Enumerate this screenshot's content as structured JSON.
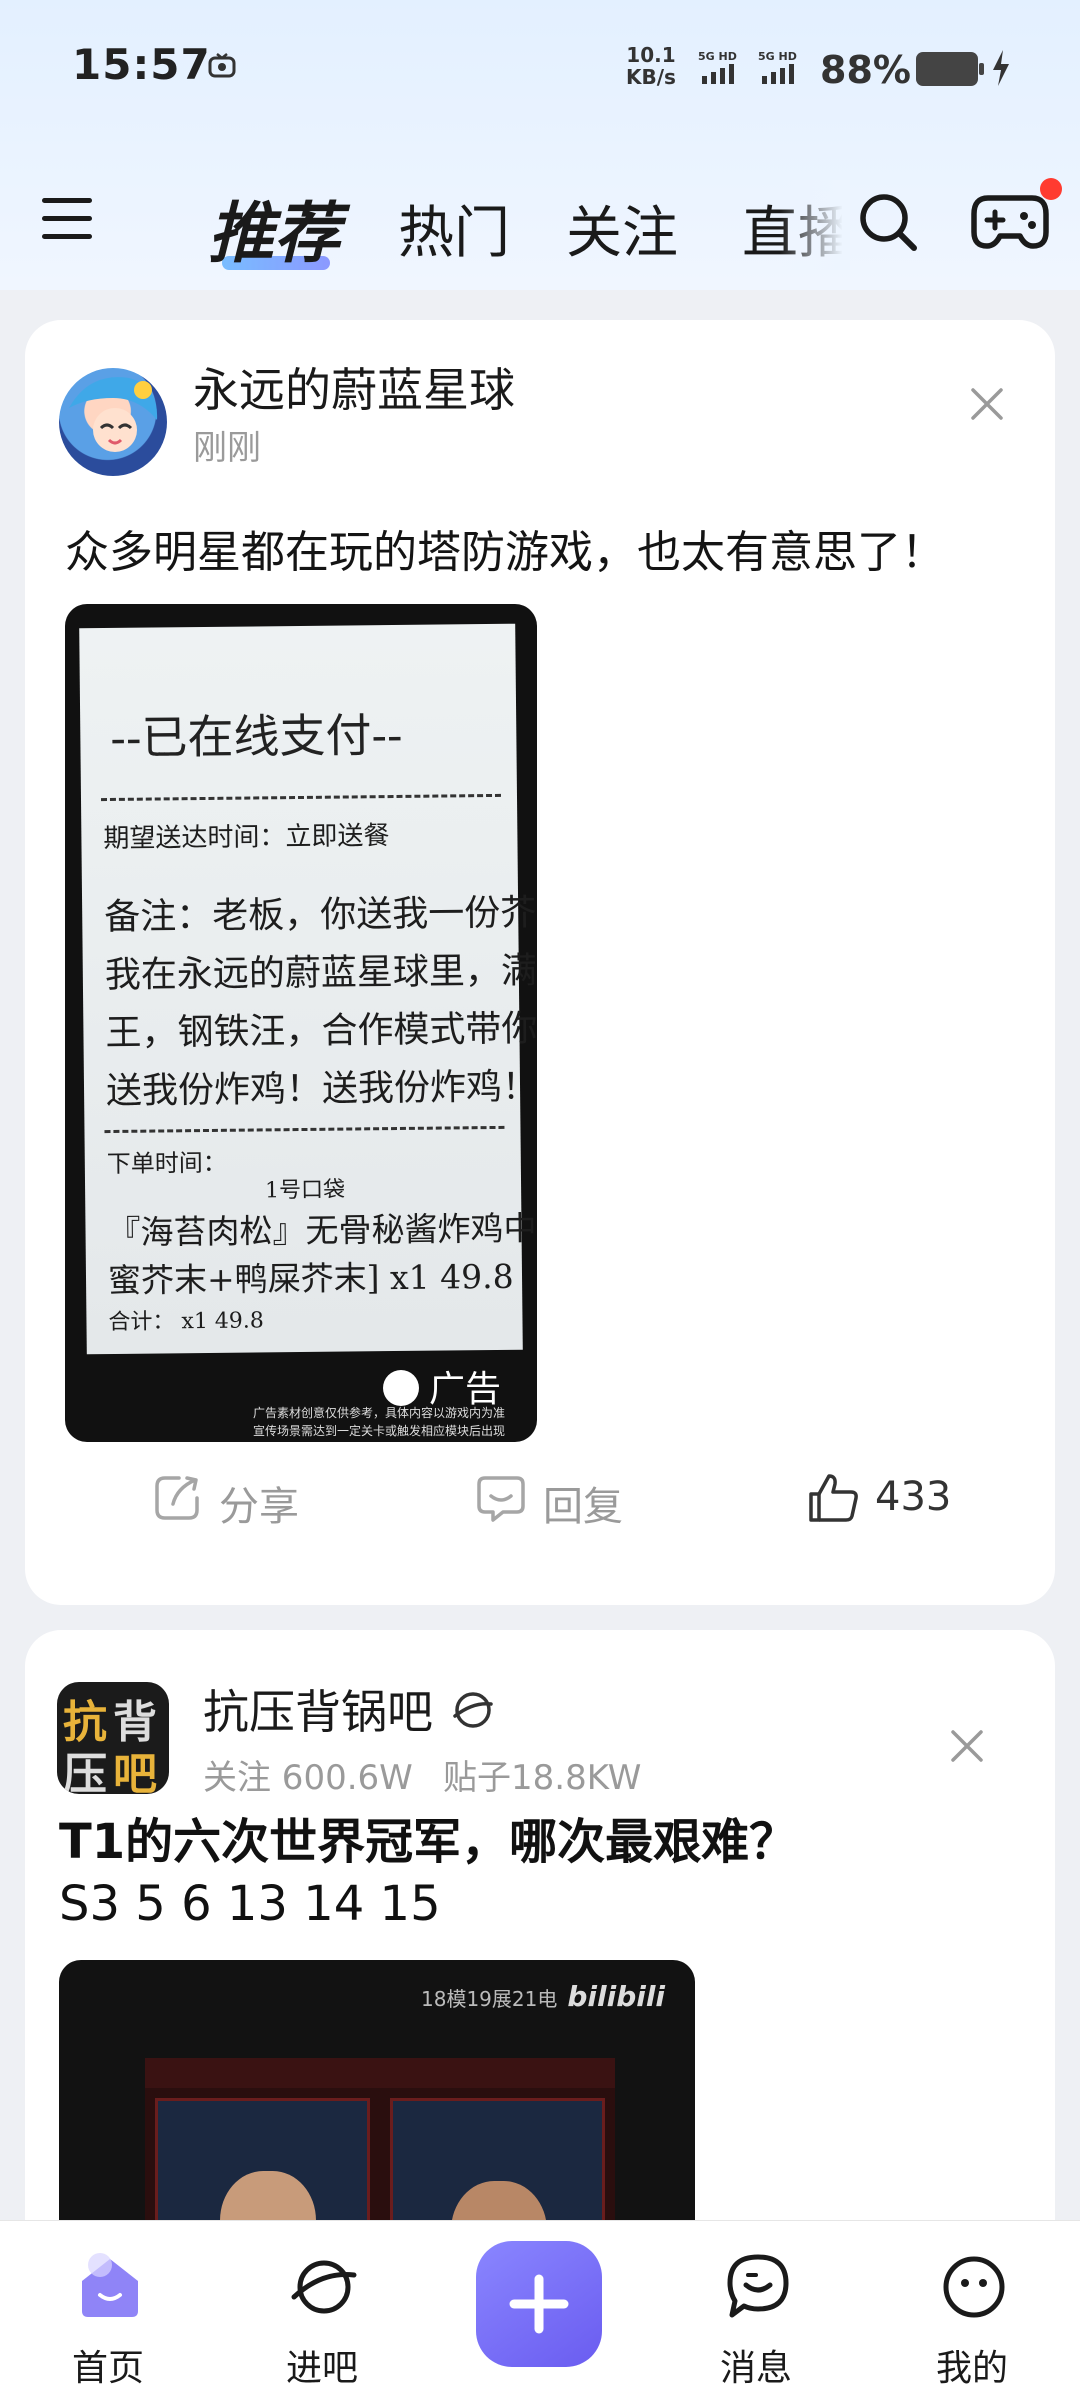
{
  "status_bar": {
    "time": "15:57",
    "net_speed_value": "10.1",
    "net_speed_unit": "KB/s",
    "sim1": "5G HD",
    "sim2": "5G HD",
    "battery": "88%"
  },
  "nav": {
    "tabs": [
      "推荐",
      "热门",
      "关注",
      "直播"
    ],
    "active_tab": "推荐",
    "accent": "#6a8bff",
    "badge_color": "#ff3b30"
  },
  "post1": {
    "author": "永远的蔚蓝星球",
    "time": "刚刚",
    "text": "众多明星都在玩的塔防游戏，也太有意思了！",
    "image": {
      "receipt_title": "--已在线支付--",
      "line1": "期望送达时间：立即送餐",
      "note1": "备注：老板，你送我一份芥末炸鸡",
      "note2": "我在永远的蔚蓝星球里，满星海",
      "note3": "王，钢铁汪，合作模式带你上分",
      "note4": "送我份炸鸡！送我份炸鸡！",
      "order_time": "下单时间：",
      "bag": "1号口袋",
      "item1": "『海苔肉松』无骨秘酱炸鸡中份[蜂",
      "item2": "蜜芥末+鸭屎芥末]     x1  49.8",
      "item3": "合计：                     x1  49.8",
      "ad_label": "广告",
      "ad_note1": "广告素材创意仅供参考，具体内容以游戏内为准",
      "ad_note2": "宣传场景需达到一定关卡或触发相应模块后出现"
    },
    "actions": {
      "share": "分享",
      "reply": "回复",
      "likes": "433"
    }
  },
  "post2": {
    "forum": "抗压背锅吧",
    "followers": "关注 600.6W",
    "posts": "贴子18.8KW",
    "title": "T1的六次世界冠军，哪次最艰难？",
    "body": "S3 5 6 13 14 15",
    "video_tag": "18模19展21电",
    "video_brand": "bilibili"
  },
  "bottom_nav": {
    "items": [
      "首页",
      "进吧",
      "消息",
      "我的"
    ],
    "active": "首页",
    "active_color": "#7b6cf6"
  }
}
